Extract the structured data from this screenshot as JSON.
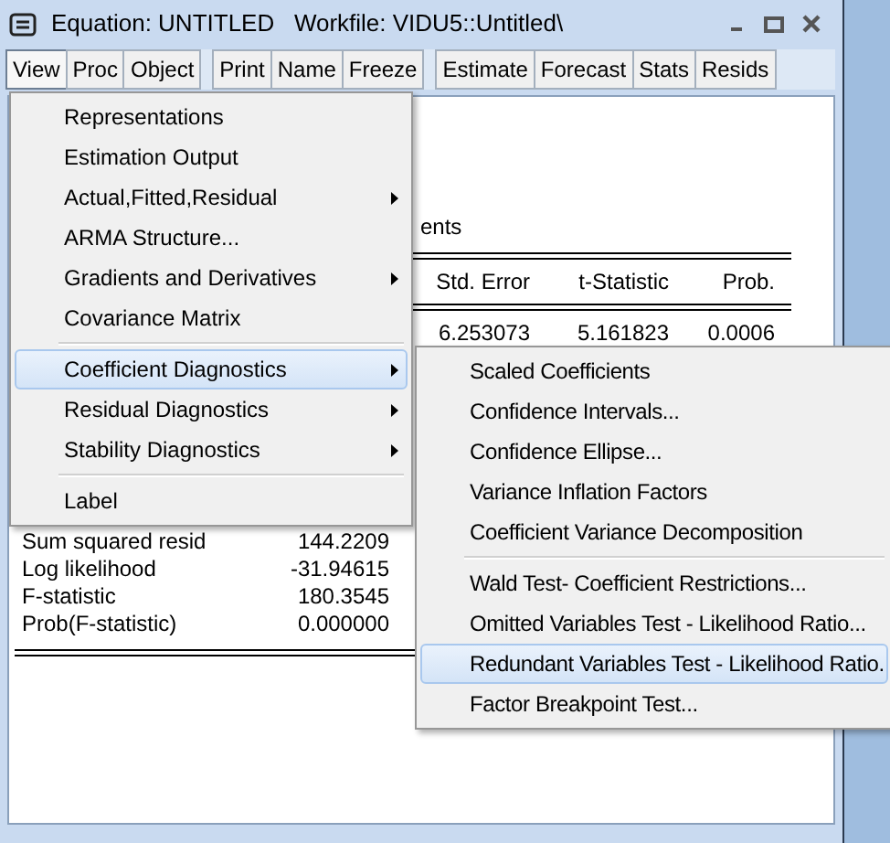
{
  "window": {
    "title": "Equation: UNTITLED   Workfile: VIDU5::Untitled\\"
  },
  "toolbar": {
    "groups": [
      [
        {
          "label": "View",
          "selected": true
        },
        {
          "label": "Proc",
          "selected": false
        },
        {
          "label": "Object",
          "selected": false
        }
      ],
      [
        {
          "label": "Print",
          "selected": false
        },
        {
          "label": "Name",
          "selected": false
        },
        {
          "label": "Freeze",
          "selected": false
        }
      ],
      [
        {
          "label": "Estimate",
          "selected": false
        },
        {
          "label": "Forecast",
          "selected": false
        },
        {
          "label": "Stats",
          "selected": false
        },
        {
          "label": "Resids",
          "selected": false
        }
      ]
    ]
  },
  "output": {
    "heading_fragment": "ents",
    "columns": [
      "Std. Error",
      "t-Statistic",
      "Prob."
    ],
    "rows": [
      [
        "6.253073",
        "5.161823",
        "0.0006"
      ]
    ],
    "stats": [
      {
        "label": "Sum squared resid",
        "value": "144.2209"
      },
      {
        "label": "Log likelihood",
        "value": "-31.94615"
      },
      {
        "label": "F-statistic",
        "value": "180.3545"
      },
      {
        "label": "Prob(F-statistic)",
        "value": "0.000000"
      }
    ]
  },
  "view_menu": {
    "items": [
      {
        "kind": "item",
        "label": "Representations",
        "submenu": false,
        "selected": false
      },
      {
        "kind": "item",
        "label": "Estimation Output",
        "submenu": false,
        "selected": false
      },
      {
        "kind": "item",
        "label": "Actual,Fitted,Residual",
        "submenu": true,
        "selected": false
      },
      {
        "kind": "item",
        "label": "ARMA Structure...",
        "submenu": false,
        "selected": false
      },
      {
        "kind": "item",
        "label": "Gradients and Derivatives",
        "submenu": true,
        "selected": false
      },
      {
        "kind": "item",
        "label": "Covariance Matrix",
        "submenu": false,
        "selected": false
      },
      {
        "kind": "separator"
      },
      {
        "kind": "item",
        "label": "Coefficient Diagnostics",
        "submenu": true,
        "selected": true
      },
      {
        "kind": "item",
        "label": "Residual Diagnostics",
        "submenu": true,
        "selected": false
      },
      {
        "kind": "item",
        "label": "Stability Diagnostics",
        "submenu": true,
        "selected": false
      },
      {
        "kind": "separator"
      },
      {
        "kind": "item",
        "label": "Label",
        "submenu": false,
        "selected": false
      }
    ]
  },
  "submenu": {
    "items": [
      {
        "kind": "item",
        "label": "Scaled Coefficients",
        "selected": false
      },
      {
        "kind": "item",
        "label": "Confidence Intervals...",
        "selected": false
      },
      {
        "kind": "item",
        "label": "Confidence Ellipse...",
        "selected": false
      },
      {
        "kind": "item",
        "label": "Variance Inflation Factors",
        "selected": false
      },
      {
        "kind": "item",
        "label": "Coefficient Variance Decomposition",
        "selected": false
      },
      {
        "kind": "separator"
      },
      {
        "kind": "item",
        "label": "Wald Test- Coefficient Restrictions...",
        "selected": false
      },
      {
        "kind": "item",
        "label": "Omitted Variables Test - Likelihood Ratio...",
        "selected": false
      },
      {
        "kind": "item",
        "label": "Redundant Variables Test - Likelihood Ratio.",
        "selected": true
      },
      {
        "kind": "item",
        "label": "Factor Breakpoint Test...",
        "selected": false
      }
    ]
  }
}
